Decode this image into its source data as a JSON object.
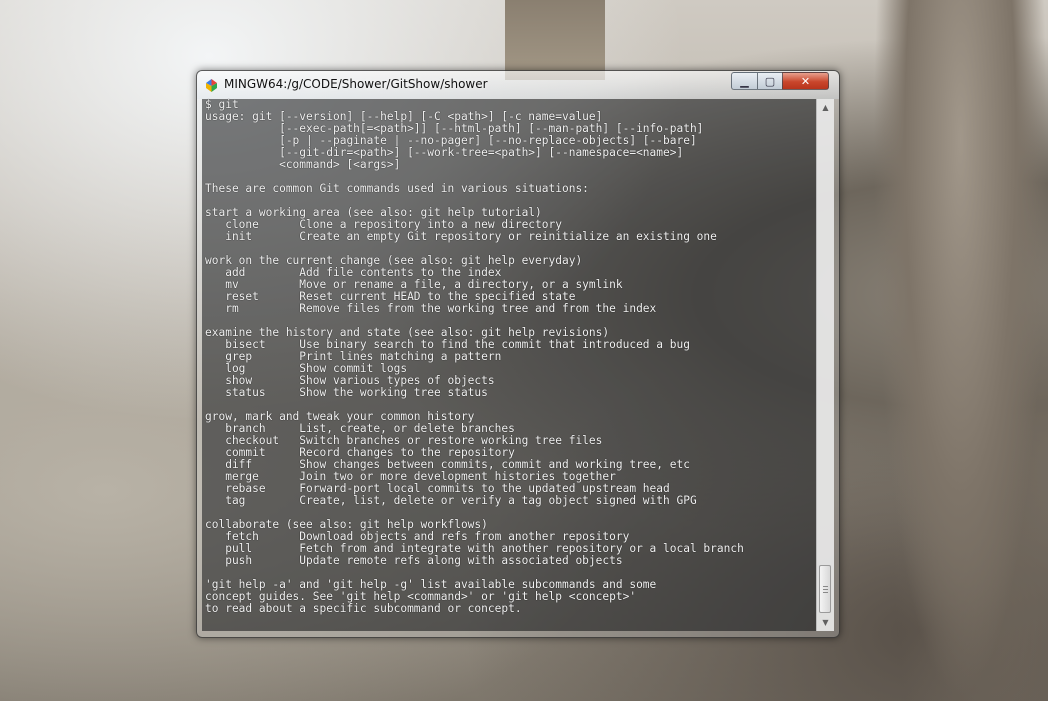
{
  "window": {
    "title": "MINGW64:/g/CODE/Shower/GitShow/shower",
    "controls": {
      "minimize": "▁",
      "maximize": "▢",
      "close": "✕"
    }
  },
  "terminal": {
    "lines": [
      "$ git",
      "usage: git [--version] [--help] [-C <path>] [-c name=value]",
      "           [--exec-path[=<path>]] [--html-path] [--man-path] [--info-path]",
      "           [-p | --paginate | --no-pager] [--no-replace-objects] [--bare]",
      "           [--git-dir=<path>] [--work-tree=<path>] [--namespace=<name>]",
      "           <command> [<args>]",
      "",
      "These are common Git commands used in various situations:",
      "",
      "start a working area (see also: git help tutorial)",
      "   clone      Clone a repository into a new directory",
      "   init       Create an empty Git repository or reinitialize an existing one",
      "",
      "work on the current change (see also: git help everyday)",
      "   add        Add file contents to the index",
      "   mv         Move or rename a file, a directory, or a symlink",
      "   reset      Reset current HEAD to the specified state",
      "   rm         Remove files from the working tree and from the index",
      "",
      "examine the history and state (see also: git help revisions)",
      "   bisect     Use binary search to find the commit that introduced a bug",
      "   grep       Print lines matching a pattern",
      "   log        Show commit logs",
      "   show       Show various types of objects",
      "   status     Show the working tree status",
      "",
      "grow, mark and tweak your common history",
      "   branch     List, create, or delete branches",
      "   checkout   Switch branches or restore working tree files",
      "   commit     Record changes to the repository",
      "   diff       Show changes between commits, commit and working tree, etc",
      "   merge      Join two or more development histories together",
      "   rebase     Forward-port local commits to the updated upstream head",
      "   tag        Create, list, delete or verify a tag object signed with GPG",
      "",
      "collaborate (see also: git help workflows)",
      "   fetch      Download objects and refs from another repository",
      "   pull       Fetch from and integrate with another repository or a local branch",
      "   push       Update remote refs along with associated objects",
      "",
      "'git help -a' and 'git help -g' list available subcommands and some",
      "concept guides. See 'git help <command>' or 'git help <concept>'",
      "to read about a specific subcommand or concept."
    ]
  },
  "scrollbar": {
    "up_arrow": "▲",
    "down_arrow": "▼",
    "position_fraction": 0.97
  },
  "colors": {
    "close_button": "#c9462c",
    "console_text": "#f2f2f2"
  }
}
